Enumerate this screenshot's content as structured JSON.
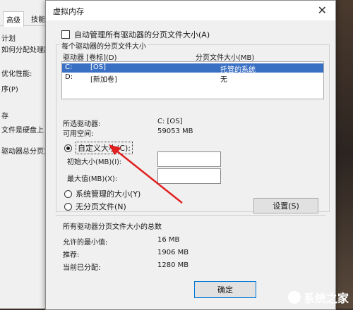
{
  "background": {
    "tabs": [
      "高级",
      "技能"
    ],
    "lines": [
      "计划",
      "如何分配处理器",
      "优化性能:",
      "序(P)",
      "存",
      "文件是硬盘上",
      "驱动器总分页文"
    ]
  },
  "dialog": {
    "title": "虚拟内存",
    "auto_manage_label": "自动管理所有驱动器的分页文件大小(A)",
    "auto_manage_checked": false,
    "per_drive_group": "每个驱动器的分页文件大小",
    "col_drive": "驱动器 [卷标](D)",
    "col_size": "分页文件大小(MB)",
    "drives": [
      {
        "letter": "C:",
        "label": "[OS]",
        "size": "托管的系统",
        "selected": true
      },
      {
        "letter": "D:",
        "label": "[新加卷]",
        "size": "无",
        "selected": false
      }
    ],
    "selected_drive_label": "所选驱动器:",
    "selected_drive_value": "C:  [OS]",
    "free_space_label": "可用空间:",
    "free_space_value": "59053 MB",
    "custom_size_label": "自定义大小(C):",
    "initial_size_label": "初始大小(MB)(I):",
    "initial_size_value": "",
    "max_size_label": "最大值(MB)(X):",
    "max_size_value": "",
    "system_managed_label": "系统管理的大小(Y)",
    "no_paging_label": "无分页文件(N)",
    "set_button": "设置(S)",
    "total_group": "所有驱动器分页文件大小的总数",
    "min_allowed_label": "允许的最小值:",
    "min_allowed_value": "16 MB",
    "recommended_label": "推荐:",
    "recommended_value": "1906 MB",
    "current_label": "当前已分配:",
    "current_value": "1280 MB",
    "ok_button": "确定"
  },
  "watermark": {
    "text": "系统之家"
  },
  "colors": {
    "selection": "#3a70c4",
    "arrow": "#e02020"
  }
}
